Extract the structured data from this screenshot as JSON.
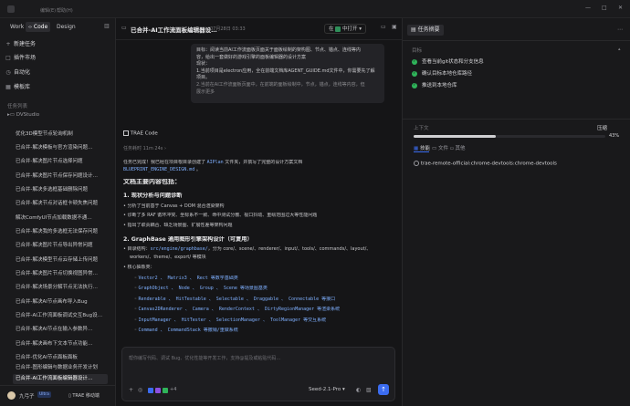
{
  "topbar": {
    "menu1": "编辑(E)",
    "menu2": "帮助(H)"
  },
  "sidebar": {
    "modes": [
      "Work",
      "Code",
      "Design"
    ],
    "nav": [
      {
        "icon": "+",
        "label": "新建任务"
      },
      {
        "icon": "□",
        "label": "插件市场"
      },
      {
        "icon": "◷",
        "label": "自动化"
      },
      {
        "icon": "▦",
        "label": "模板库"
      }
    ],
    "section_label": "任务列表",
    "group_label": "DVStudio",
    "tasks": [
      "优化3D模型节点轮询机制",
      "已合并-解决模板与官方渲染问题…",
      "已合并-解决图片节点选择问题",
      "已合并-解决图片节点保存问题设计…",
      "已合并-解决多选框基础删除问题",
      "已合并-解决节点对话框卡顿失焦问题",
      "解决ComfyUI节点加载数据不通…",
      "已合并-解决我的多选框无法保存问题",
      "已合并-解决图片节点导出异常问题",
      "已合并-解决模型节点云存储上传问题",
      "已合并-解决图片节点切换视图异常…",
      "已合并-解决场景分解节点无法执行…",
      "已合并-解决AI节点画布导入Bug",
      "已合并-AI工作流面板调试交互Bug设…",
      "已合并-解决AI节点在输入参数异…",
      "已合并-解决画布下文本节点功能…",
      "已合并-优化AI节点面板面板",
      "已合并-图形编辑与数据业务开发计划",
      "已合并-AI工作流面板编辑器设计…"
    ],
    "user": {
      "name": "九弓子",
      "badge": "Ultra",
      "app_label": "TRAE 移动端"
    }
  },
  "chat": {
    "title": "已合并-AI工作流面板编辑器设…",
    "date": "07月28日 03:33",
    "menu_items": [
      "在",
      "中打开"
    ],
    "user_msg_lines": [
      "目标：阅读当前AI工作流面板页面关于面板绘制的架构图、节点、锚点、连线等内",
      "容，给出一套做好的游戏引擎的面板编辑器的设计方案",
      "现状：",
      "1.当前项目是electron应用，全在前端文档库AGENT_GUIDE.md文件中，你需要先了解项目。",
      "2.当前在AI工作流面板页面中，在前端的面板绘制中，节点，锚点，连线等内容，但",
      "展示更多"
    ],
    "assistant_name": "TRAE Code",
    "elapsed": "任务耗时 11m 24s",
    "answer": {
      "intro_a": "任务已完成！我已经在项目根目录创建了",
      "intro_code": "AIPlan",
      "intro_b": "文件夹，并撰写了完整的设计方案文档",
      "doc_name": "BLUEPRINT_ENGINE_DESIGN.md",
      "doc_h": "文档主要内容包括：",
      "sec1": "1. 现状分析与问题诊断",
      "sec1_items": [
        "分析了当前基于 Canvas + DOM 混合渲染架构",
        "诊断了多 RAF 循环冲突、坐标系不一致、命中测试分散、视口抖动、重绘范围过大等性能问题",
        "指出了职责耦合、缺乏场景图、扩展性差等架构问题"
      ],
      "sec2": "2. GraphBase 通用图形引擎架构设计（可复用）",
      "sec2_a": "目录结构：",
      "sec2_code": "src/engine/graphbase/",
      "sec2_b": "，分为 core/、scene/、renderer/、input/、tools/、commands/、layout/、",
      "sec2_c": "workers/、theme/、export/ 等模块",
      "core_label": "核心抽象类：",
      "core_items": [
        "Vector2 、 Matrix3 、 Rect 等数学基础类",
        "GraphObject 、 Node 、 Group 、 Scene 等场景图基类",
        "Renderable 、 HitTestable 、 Selectable 、 Draggable 、 Connectable 等接口",
        "Canvas2DRenderer 、 Camera 、 RenderContext 、 DirtyRegionManager 等渲染系统",
        "InputManager 、 HitTester 、 SelectionManager 、 ToolManager 等交互系统",
        "Command 、 CommandStack 等撤销/重做系统"
      ]
    },
    "input_placeholder": "帮你编写代码、调试 Bug、优化性能等开发工作，支持@提及或粘贴代码…",
    "model": "Seed-2.1-Pro",
    "attach_count": "+4"
  },
  "panel": {
    "tabs": [
      "任务摘要"
    ],
    "goal_label": "目标",
    "checklist": [
      "查看当前git状态和分支信息",
      "确认目标本地仓库路径",
      "推送到本地仓库"
    ],
    "stats_label": "上下文",
    "compress_label": "压缩",
    "progress": 0.43,
    "progress_text": "43%",
    "subtabs": [
      "技能",
      "文件",
      "其他"
    ],
    "tool_item": "trae-remote-official:chrome-devtools:chrome-devtools"
  },
  "colors": {
    "accent": "#3b6cf0",
    "check": "#2fb45a",
    "progress": "#cfcfd2"
  }
}
